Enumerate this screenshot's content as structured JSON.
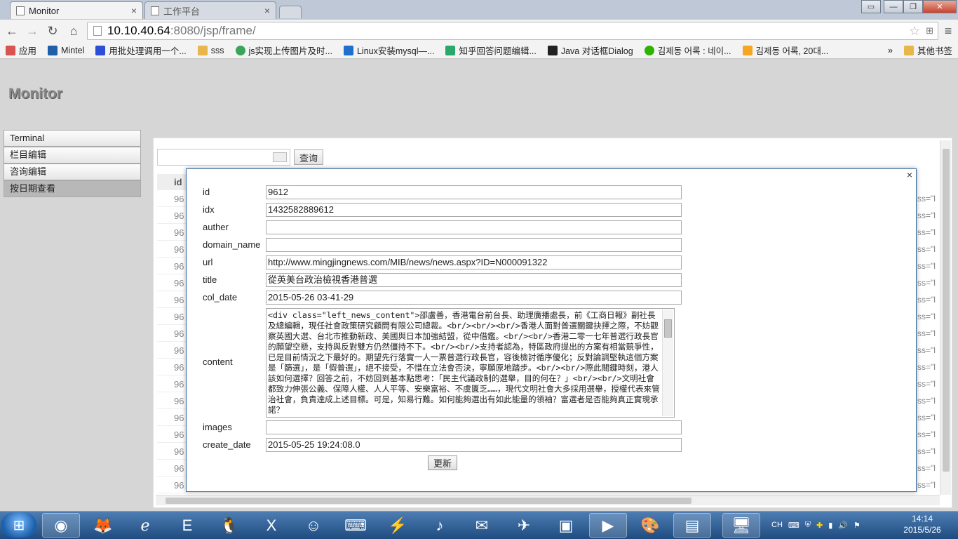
{
  "browser": {
    "tabs": [
      {
        "label": "Monitor",
        "active": true
      },
      {
        "label": "工作平台",
        "active": false
      }
    ],
    "url_host": "10.10.40.64",
    "url_rest": ":8080/jsp/frame/",
    "bookmarks": [
      {
        "label": "应用",
        "icon": "apps-icon",
        "color": "#d9534f"
      },
      {
        "label": "Mintel",
        "icon": "mintel-icon",
        "color": "#1f5fa8"
      },
      {
        "label": "用批处理调用一个...",
        "icon": "baidu-icon",
        "color": "#2a4fd6"
      },
      {
        "label": "sss",
        "icon": "folder-icon",
        "color": "#e8b64a"
      },
      {
        "label": "js实现上传图片及时...",
        "icon": "cnblogs-icon",
        "color": "#3aa55a"
      },
      {
        "label": "Linux安装mysql—...",
        "icon": "oschina-icon",
        "color": "#1f6fcf"
      },
      {
        "label": "知乎回答问题编辑...",
        "icon": "zhihu-icon",
        "color": "#2aa86a"
      },
      {
        "label": "Java 对话框Dialog",
        "icon": "b-icon",
        "color": "#222222"
      },
      {
        "label": "김제동 어록 : 네이...",
        "icon": "naver-icon",
        "color": "#2db400"
      },
      {
        "label": "김제동 어록, 20대...",
        "icon": "bing-icon",
        "color": "#f5a623"
      }
    ],
    "more": "»",
    "other_bookmarks": "其他书签"
  },
  "app": {
    "title": "Monitor",
    "sidebar": [
      "Terminal",
      "栏目编辑",
      "咨询编辑",
      "按日期查看"
    ],
    "query_label": "查询",
    "table_header": "id",
    "row_prefix": "96",
    "row_suffix": "ss=\"l"
  },
  "modal": {
    "close": "×",
    "fields": [
      {
        "label": "id",
        "value": "9612"
      },
      {
        "label": "idx",
        "value": "1432582889612"
      },
      {
        "label": "auther",
        "value": ""
      },
      {
        "label": "domain_name",
        "value": ""
      },
      {
        "label": "url",
        "value": "http://www.mingjingnews.com/MIB/news/news.aspx?ID=N000091322"
      },
      {
        "label": "title",
        "value": "從英美台政治檢視香港普選"
      },
      {
        "label": "col_date",
        "value": "2015-05-26 03-41-29"
      }
    ],
    "content_label": "content",
    "content_value": "<div class=\"left_news_content\">邵盧善，香港電台前台長、助理廣播處長，前《工商日報》副社長及總編輯，現任社會政策研究顧問有限公司總裁。<br/><br/><br/>香港人面對普選關鍵抉擇之際，不妨觀察英國大選、台北市推動新政、美國與日本加強結盟，從中借鑑。<br/><br/>香港二零一七年普選行政長官的願望空懸，支持與反對雙方仍然僵持不下。<br/><br/>支持者認為，特區政府提出的方案有相當競爭性，已是目前情況之下最好的。期望先行落實一人一票普選行政長官，容後檢討循序優化；反對論調堅執這個方案是「篩選」，是「假普選」，絕不接受，不惜在立法會否決，寧願原地踏步。<br/><br/>際此關鍵時刻，港人該如何選擇？回答之前，不妨回到基本點思考：「民主代議政制的選舉，目的何在？」<br/><br/>文明社會都致力伸張公義、保障人權、人人平等、安樂富裕、不虞匱乏……，現代文明社會大多採用選舉，授權代表來管治社會，負責達成上述目標。可是，知易行難。如何能夠選出有如此能量的領袖？富選者是否能夠真正實現承諾？",
    "bottom_fields": [
      {
        "label": "images",
        "value": ""
      },
      {
        "label": "create_date",
        "value": "2015-05-25 19:24:08.0"
      }
    ],
    "update_label": "更新"
  },
  "taskbar": {
    "ime": "CH",
    "time": "14:14",
    "date": "2015/5/26"
  }
}
